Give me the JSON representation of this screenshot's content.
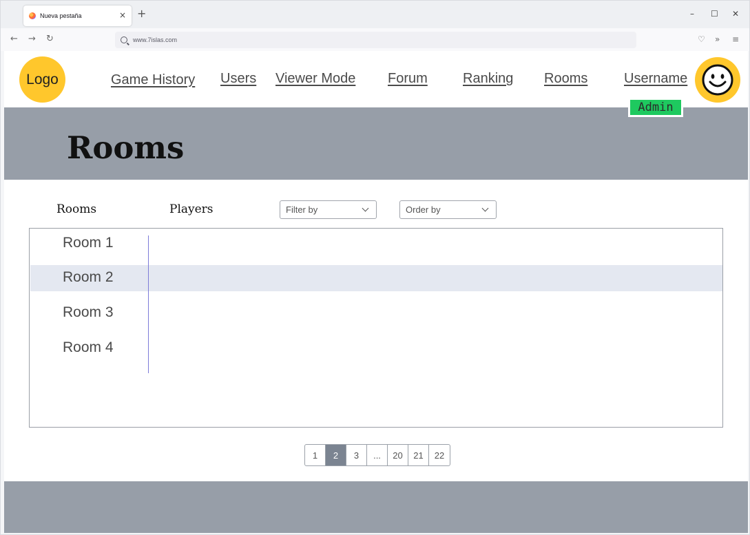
{
  "browser": {
    "tab_title": "Nueva pestaña",
    "tab_close": "×",
    "new_tab": "+",
    "url": "www.7islas.com",
    "window_controls": {
      "minimize": "–",
      "maximize": "☐",
      "close": "✕"
    },
    "nav_icons": {
      "back": "←",
      "forward": "→",
      "reload": "↻",
      "shield": "♡",
      "overflow": "»",
      "menu": "≡"
    }
  },
  "header": {
    "logo": "Logo",
    "nav": [
      "Game History",
      "Users",
      "Viewer Mode",
      "Forum",
      "Ranking",
      "Rooms"
    ],
    "username": "Username",
    "role": "Admin"
  },
  "hero": {
    "title": "Rooms"
  },
  "columns": {
    "rooms": "Rooms",
    "players": "Players"
  },
  "filters": {
    "filter_placeholder": "Filter by",
    "order_placeholder": "Order by"
  },
  "rooms": [
    {
      "name": "Room 1"
    },
    {
      "name": "Room 2"
    },
    {
      "name": "Room 3"
    },
    {
      "name": "Room 4"
    }
  ],
  "selected_room": "Room 2",
  "pagination": {
    "pages": [
      "1",
      "2",
      "3",
      "...",
      "20",
      "21",
      "22"
    ],
    "current": "2"
  },
  "colors": {
    "accent": "#ffc72c",
    "badge": "#1ec95f",
    "band": "#979ea8",
    "active_page": "#7b8491",
    "selected_row": "#e4e8f1"
  }
}
